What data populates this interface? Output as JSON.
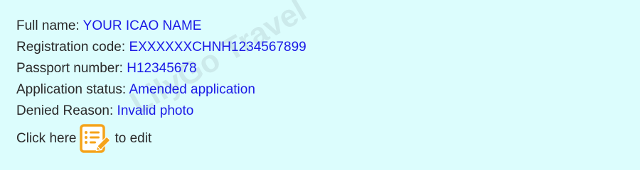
{
  "fields": {
    "full_name": {
      "label": "Full name:",
      "value": "YOUR ICAO NAME"
    },
    "registration_code": {
      "label": "Registration code:",
      "value": "EXXXXXXCHNH1234567899"
    },
    "passport_number": {
      "label": "Passport number:",
      "value": "H12345678"
    },
    "application_status": {
      "label": "Application status:",
      "value": "Amended application"
    },
    "denied_reason": {
      "label": "Denied Reason:",
      "value": "Invalid photo"
    }
  },
  "edit": {
    "prefix": "Click here",
    "suffix": "to edit",
    "icon": "edit-document-icon"
  },
  "watermark": "LilyGo Travel",
  "colors": {
    "background": "#dcfdfd",
    "label": "#2a2a2a",
    "value": "#1a1ae6",
    "icon_orange": "#f5a31a"
  }
}
